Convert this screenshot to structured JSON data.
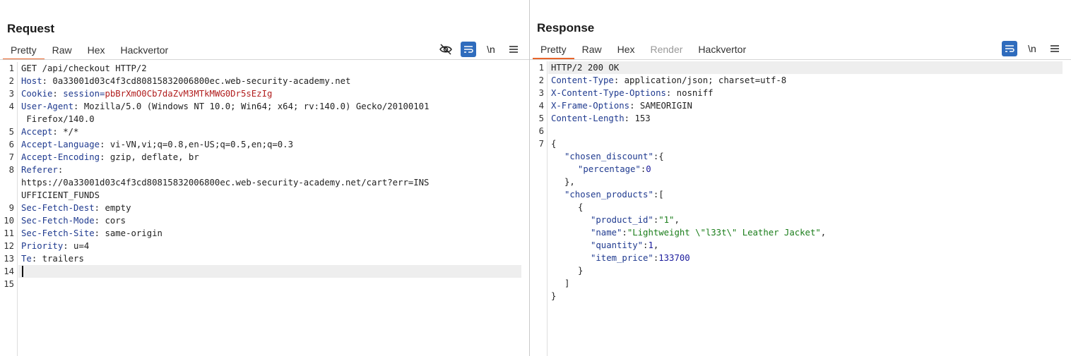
{
  "request": {
    "title": "Request",
    "tabs": [
      {
        "label": "Pretty",
        "active": true
      },
      {
        "label": "Raw"
      },
      {
        "label": "Hex"
      },
      {
        "label": "Hackvertor"
      }
    ],
    "tools": [
      "hide-icon",
      "wrap-icon",
      "newline-icon",
      "menu-icon"
    ],
    "newline_label": "\\n",
    "line_numbers": [
      "1",
      "2",
      "3",
      "4",
      "5",
      "6",
      "7",
      "8",
      "9",
      "10",
      "11",
      "12",
      "13",
      "14",
      "15"
    ],
    "lines": [
      {
        "text": "GET /api/checkout HTTP/2"
      },
      {
        "key": "Host",
        "value": " 0a33001d03c4f3cd80815832006800ec.web-security-academy.net"
      },
      {
        "key": "Cookie",
        "value": " session=",
        "cookie": "pbBrXmO0Cb7daZvM3MTkMWG0Dr5sEzIg"
      },
      {
        "key": "User-Agent",
        "value": " Mozilla/5.0 (Windows NT 10.0; Win64; x64; rv:140.0) Gecko/20100101",
        "cont": " Firefox/140.0"
      },
      {
        "key": "Accept",
        "value": " */*"
      },
      {
        "key": "Accept-Language",
        "value": " vi-VN,vi;q=0.8,en-US;q=0.5,en;q=0.3"
      },
      {
        "key": "Accept-Encoding",
        "value": " gzip, deflate, br"
      },
      {
        "key": "Referer",
        "value": "",
        "cont": "https://0a33001d03c4f3cd80815832006800ec.web-security-academy.net/cart?err=INS",
        "cont2": "UFFICIENT_FUNDS"
      },
      {
        "key": "Sec-Fetch-Dest",
        "value": " empty"
      },
      {
        "key": "Sec-Fetch-Mode",
        "value": " cors"
      },
      {
        "key": "Sec-Fetch-Site",
        "value": " same-origin"
      },
      {
        "key": "Priority",
        "value": " u=4"
      },
      {
        "key": "Te",
        "value": " trailers"
      },
      {
        "text": ""
      },
      {
        "text": ""
      }
    ]
  },
  "response": {
    "title": "Response",
    "tabs": [
      {
        "label": "Pretty",
        "active": true
      },
      {
        "label": "Raw"
      },
      {
        "label": "Hex"
      },
      {
        "label": "Render",
        "disabled": true
      },
      {
        "label": "Hackvertor"
      }
    ],
    "newline_label": "\\n",
    "line_numbers": [
      "1",
      "2",
      "3",
      "4",
      "5",
      "6",
      "7"
    ],
    "status_line": "HTTP/2 200 OK",
    "headers": [
      {
        "key": "Content-Type",
        "value": " application/json; charset=utf-8"
      },
      {
        "key": "X-Content-Type-Options",
        "value": " nosniff"
      },
      {
        "key": "X-Frame-Options",
        "value": " SAMEORIGIN"
      },
      {
        "key": "Content-Length",
        "value": " 153"
      }
    ],
    "json": {
      "open": "{",
      "chosen_discount_key": "\"chosen_discount\"",
      "percentage_key": "\"percentage\"",
      "percentage_val": "0",
      "chosen_products_key": "\"chosen_products\"",
      "product_id_key": "\"product_id\"",
      "product_id_val": "\"1\"",
      "name_key": "\"name\"",
      "name_val": "\"Lightweight \\\"l33t\\\" Leather Jacket\"",
      "quantity_key": "\"quantity\"",
      "quantity_val": "1",
      "item_price_key": "\"item_price\"",
      "item_price_val": "133700"
    }
  },
  "layout_buttons": [
    "split-horizontal-icon",
    "split-vertical-icon",
    "single-pane-icon"
  ],
  "colors": {
    "accent": "#e8652b",
    "active_button": "#2f6cbd",
    "header_key": "#1f3a8f",
    "cookie_value": "#b11d1d",
    "json_string": "#1a7d1a"
  }
}
